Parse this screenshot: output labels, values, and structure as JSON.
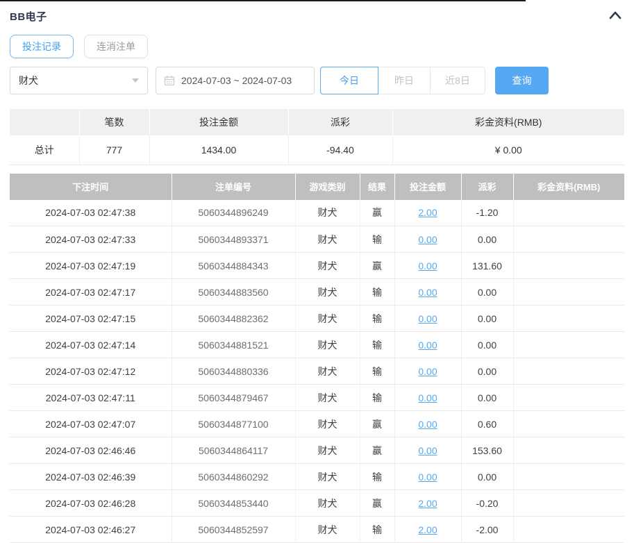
{
  "panel": {
    "title": "BB电子"
  },
  "tabs": [
    {
      "label": "投注记录",
      "active": true
    },
    {
      "label": "连消注单",
      "active": false
    }
  ],
  "filters": {
    "game_select": {
      "value": "财犬"
    },
    "date_range": {
      "value": "2024-07-03 ~ 2024-07-03"
    },
    "quick_ranges": [
      {
        "label": "今日",
        "active": true
      },
      {
        "label": "昨日",
        "active": false
      },
      {
        "label": "近8日",
        "active": false
      }
    ],
    "search_label": "查询"
  },
  "summary": {
    "columns": [
      "",
      "笔数",
      "投注金额",
      "派彩",
      "彩金资料(RMB)"
    ],
    "row": {
      "label": "总计",
      "count": "777",
      "bet_amount": "1434.00",
      "payout": "-94.40",
      "bonus": "¥ 0.00"
    }
  },
  "records": {
    "columns": [
      "下注时间",
      "注单编号",
      "游戏类别",
      "结果",
      "投注金额",
      "派彩",
      "彩金资料(RMB)"
    ],
    "rows": [
      {
        "time": "2024-07-03 02:47:38",
        "order": "5060344896249",
        "game": "财犬",
        "result": "赢",
        "bet": "2.00",
        "payout": "-1.20",
        "bonus": ""
      },
      {
        "time": "2024-07-03 02:47:33",
        "order": "5060344893371",
        "game": "财犬",
        "result": "输",
        "bet": "0.00",
        "payout": "0.00",
        "bonus": ""
      },
      {
        "time": "2024-07-03 02:47:19",
        "order": "5060344884343",
        "game": "财犬",
        "result": "赢",
        "bet": "0.00",
        "payout": "131.60",
        "bonus": ""
      },
      {
        "time": "2024-07-03 02:47:17",
        "order": "5060344883560",
        "game": "财犬",
        "result": "输",
        "bet": "0.00",
        "payout": "0.00",
        "bonus": ""
      },
      {
        "time": "2024-07-03 02:47:15",
        "order": "5060344882362",
        "game": "财犬",
        "result": "输",
        "bet": "0.00",
        "payout": "0.00",
        "bonus": ""
      },
      {
        "time": "2024-07-03 02:47:14",
        "order": "5060344881521",
        "game": "财犬",
        "result": "输",
        "bet": "0.00",
        "payout": "0.00",
        "bonus": ""
      },
      {
        "time": "2024-07-03 02:47:12",
        "order": "5060344880336",
        "game": "财犬",
        "result": "输",
        "bet": "0.00",
        "payout": "0.00",
        "bonus": ""
      },
      {
        "time": "2024-07-03 02:47:11",
        "order": "5060344879467",
        "game": "财犬",
        "result": "输",
        "bet": "0.00",
        "payout": "0.00",
        "bonus": ""
      },
      {
        "time": "2024-07-03 02:47:07",
        "order": "5060344877100",
        "game": "财犬",
        "result": "赢",
        "bet": "0.00",
        "payout": "0.60",
        "bonus": ""
      },
      {
        "time": "2024-07-03 02:46:46",
        "order": "5060344864117",
        "game": "财犬",
        "result": "赢",
        "bet": "0.00",
        "payout": "153.60",
        "bonus": ""
      },
      {
        "time": "2024-07-03 02:46:39",
        "order": "5060344860292",
        "game": "财犬",
        "result": "输",
        "bet": "0.00",
        "payout": "0.00",
        "bonus": ""
      },
      {
        "time": "2024-07-03 02:46:28",
        "order": "5060344853440",
        "game": "财犬",
        "result": "赢",
        "bet": "2.00",
        "payout": "-0.20",
        "bonus": ""
      },
      {
        "time": "2024-07-03 02:46:27",
        "order": "5060344852597",
        "game": "财犬",
        "result": "输",
        "bet": "2.00",
        "payout": "-2.00",
        "bonus": ""
      }
    ]
  },
  "colors": {
    "accent_blue": "#55a9f2",
    "negative_red": "#f25e5e",
    "table_header_gray": "#bfbfbf",
    "summary_header_gray": "#f0f0f0",
    "title_navy": "#2e3a4e"
  },
  "icons": {
    "collapse": "chevron-up",
    "select_caret": "chevron-down",
    "date": "calendar"
  }
}
